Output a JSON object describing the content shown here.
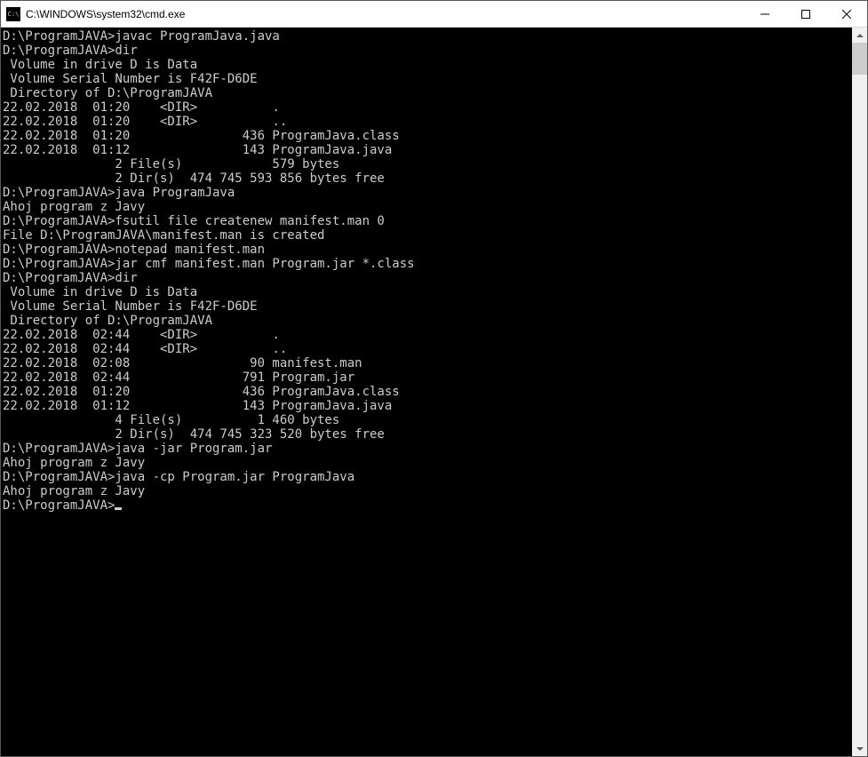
{
  "window": {
    "title": "C:\\WINDOWS\\system32\\cmd.exe",
    "icon_label": "C:\\"
  },
  "terminal": {
    "lines": [
      "D:\\ProgramJAVA>javac ProgramJava.java",
      "",
      "D:\\ProgramJAVA>dir",
      " Volume in drive D is Data",
      " Volume Serial Number is F42F-D6DE",
      "",
      " Directory of D:\\ProgramJAVA",
      "",
      "22.02.2018  01:20    <DIR>          .",
      "22.02.2018  01:20    <DIR>          ..",
      "22.02.2018  01:20               436 ProgramJava.class",
      "22.02.2018  01:12               143 ProgramJava.java",
      "               2 File(s)            579 bytes",
      "               2 Dir(s)  474 745 593 856 bytes free",
      "",
      "D:\\ProgramJAVA>java ProgramJava",
      "Ahoj program z Javy",
      "",
      "D:\\ProgramJAVA>fsutil file createnew manifest.man 0",
      "File D:\\ProgramJAVA\\manifest.man is created",
      "",
      "D:\\ProgramJAVA>notepad manifest.man",
      "",
      "D:\\ProgramJAVA>jar cmf manifest.man Program.jar *.class",
      "",
      "D:\\ProgramJAVA>dir",
      " Volume in drive D is Data",
      " Volume Serial Number is F42F-D6DE",
      "",
      " Directory of D:\\ProgramJAVA",
      "",
      "22.02.2018  02:44    <DIR>          .",
      "22.02.2018  02:44    <DIR>          ..",
      "22.02.2018  02:08                90 manifest.man",
      "22.02.2018  02:44               791 Program.jar",
      "22.02.2018  01:20               436 ProgramJava.class",
      "22.02.2018  01:12               143 ProgramJava.java",
      "               4 File(s)          1 460 bytes",
      "               2 Dir(s)  474 745 323 520 bytes free",
      "",
      "D:\\ProgramJAVA>java -jar Program.jar",
      "Ahoj program z Javy",
      "",
      "D:\\ProgramJAVA>java -cp Program.jar ProgramJava",
      "Ahoj program z Javy",
      "",
      "D:\\ProgramJAVA>"
    ]
  }
}
